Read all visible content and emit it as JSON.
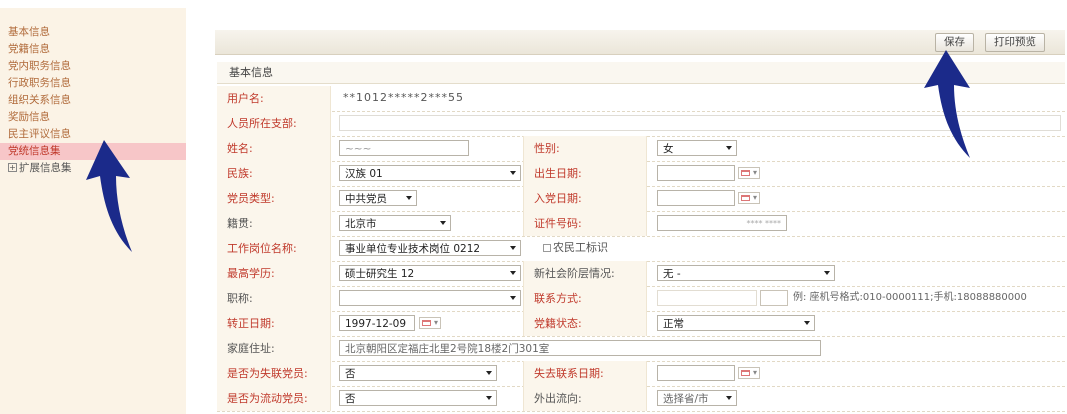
{
  "sidebar": {
    "items": [
      {
        "label": "基本信息"
      },
      {
        "label": "党籍信息"
      },
      {
        "label": "党内职务信息"
      },
      {
        "label": "行政职务信息"
      },
      {
        "label": "组织关系信息"
      },
      {
        "label": "奖励信息"
      },
      {
        "label": "民主评议信息"
      },
      {
        "label": "党统信息集"
      },
      {
        "label": "扩展信息集"
      }
    ],
    "active_index": 7
  },
  "toolbar": {
    "save_label": "保存",
    "print_preview_label": "打印预览"
  },
  "form": {
    "section_title": "基本信息",
    "username_label": "用户名:",
    "username_value": "**1012*****2***55",
    "branch_label": "人员所在支部:",
    "name_label": "姓名:",
    "name_value": "~~~",
    "gender_label": "性别:",
    "gender_value": "女",
    "ethnicity_label": "民族:",
    "ethnicity_value": "汉族 01",
    "birth_label": "出生日期:",
    "member_type_label": "党员类型:",
    "member_type_value": "中共党员",
    "join_date_label": "入党日期:",
    "native_label": "籍贯:",
    "native_value": "北京市",
    "id_label": "证件号码:",
    "id_value": "**** ****",
    "job_label": "工作岗位名称:",
    "job_value": "事业单位专业技术岗位 0212",
    "farmer_label": "农民工标识",
    "education_label": "最高学历:",
    "education_value": "硕士研究生 12",
    "social_label": "新社会阶层情况:",
    "social_value": "无 -",
    "title_label": "职称:",
    "contact_label": "联系方式:",
    "contact_hint": "例: 座机号格式:010-0000111;手机:18088880000",
    "regular_label": "转正日期:",
    "regular_value": "1997-12-09",
    "status_label": "党籍状态:",
    "status_value": "正常",
    "address_label": "家庭住址:",
    "address_value": "北京朝阳区定福庄北里2号院18楼2门301室",
    "lost_label": "是否为失联党员:",
    "lost_value": "否",
    "lost_date_label": "失去联系日期:",
    "mobile_label": "是否为流动党员:",
    "mobile_value": "否",
    "out_label": "外出流向:",
    "out_value": "选择省/市"
  },
  "icons": {
    "calendar": "calendar-icon",
    "arrow": "up-arrow-annotation",
    "expand": "plus-box-icon"
  },
  "colors": {
    "sidebar_bg": "#fbf3e6",
    "active_bg": "#f7c6c8",
    "label_red": "#c0392b",
    "arrow": "#1b2a8a"
  }
}
